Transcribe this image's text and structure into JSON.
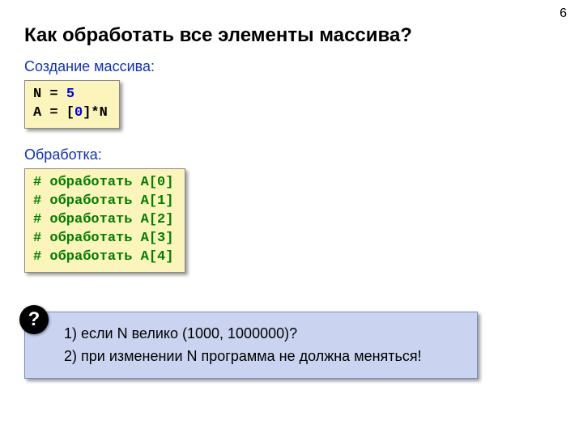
{
  "page_number": "6",
  "title": "Как обработать все элементы массива?",
  "section_create": "Создание массива:",
  "code_create": {
    "line1_a": "N = ",
    "line1_b": "5",
    "line2_a": "A = [",
    "line2_b": "0",
    "line2_c": "]*N"
  },
  "section_process": "Обработка:",
  "code_process": {
    "l0": "# обработать A[0]",
    "l1": "# обработать A[1]",
    "l2": "# обработать A[2]",
    "l3": "# обработать A[3]",
    "l4": "# обработать A[4]"
  },
  "question_mark": "?",
  "note1": "1) если N велико (1000, 1000000)?",
  "note2": "2) при изменении N программа не должна меняться!"
}
